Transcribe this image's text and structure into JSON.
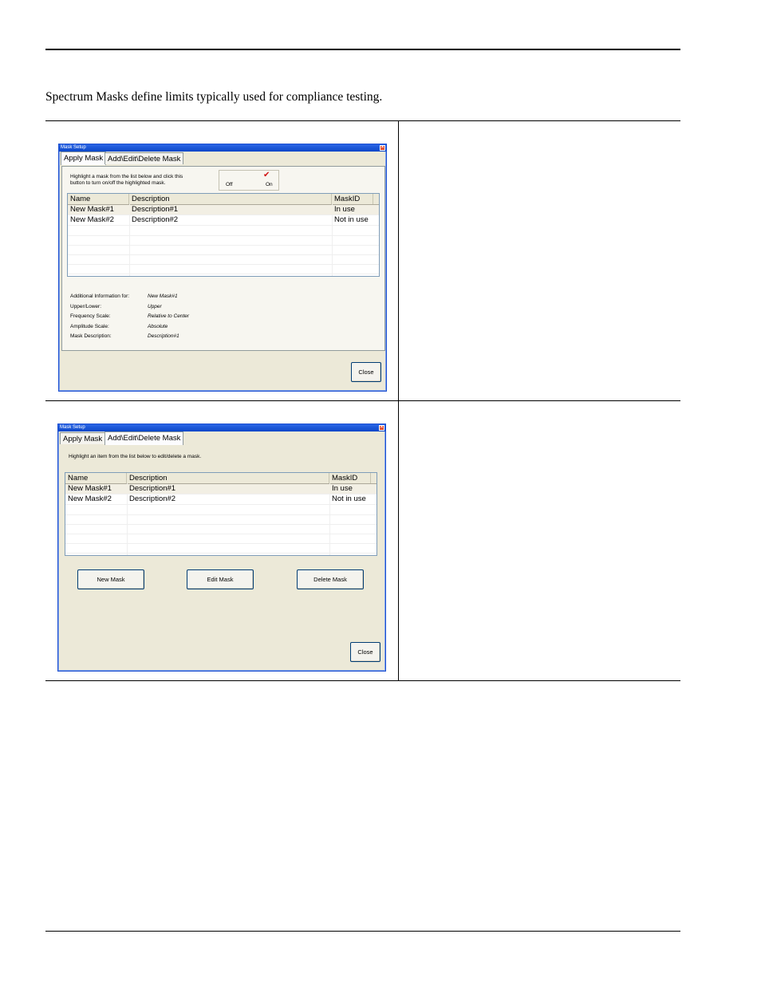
{
  "intro_text": "Spectrum Masks define limits typically used for compliance testing.",
  "window1": {
    "title": "Mask Setup",
    "tabs": [
      "Apply Mask",
      "Add\\Edit\\Delete Mask"
    ],
    "instruction_line1": "Highlight a mask from the list below and click this",
    "instruction_line2": "button to turn on/off the highlighted mask.",
    "toggle": {
      "off_label": "Off",
      "on_label": "On",
      "check_mark": "✔"
    },
    "columns": [
      "Name",
      "Description",
      "MaskID"
    ],
    "rows": [
      {
        "name": "New Mask#1",
        "description": "Description#1",
        "mask_id": "In use"
      },
      {
        "name": "New Mask#2",
        "description": "Description#2",
        "mask_id": "Not in use"
      }
    ],
    "info": {
      "additional_label": "Additional Information for:",
      "additional_value": "New Mask#1",
      "upper_lower_label": "Upper/Lower:",
      "upper_lower_value": "Upper",
      "freq_scale_label": "Frequency Scale:",
      "freq_scale_value": "Relative to Center",
      "amp_scale_label": "Amplitude Scale:",
      "amp_scale_value": "Absolute",
      "mask_desc_label": "Mask Description:",
      "mask_desc_value": "Description#1"
    },
    "close_label": "Close"
  },
  "window2": {
    "title": "Mask Setup",
    "tabs": [
      "Apply Mask",
      "Add\\Edit\\Delete Mask"
    ],
    "instruction": "Highlight an item from the list below to edit/delete a mask.",
    "columns": [
      "Name",
      "Description",
      "MaskID"
    ],
    "rows": [
      {
        "name": "New Mask#1",
        "description": "Description#1",
        "mask_id": "In use"
      },
      {
        "name": "New Mask#2",
        "description": "Description#2",
        "mask_id": "Not in use"
      }
    ],
    "new_label": "New Mask",
    "edit_label": "Edit Mask",
    "delete_label": "Delete Mask",
    "close_label": "Close"
  }
}
